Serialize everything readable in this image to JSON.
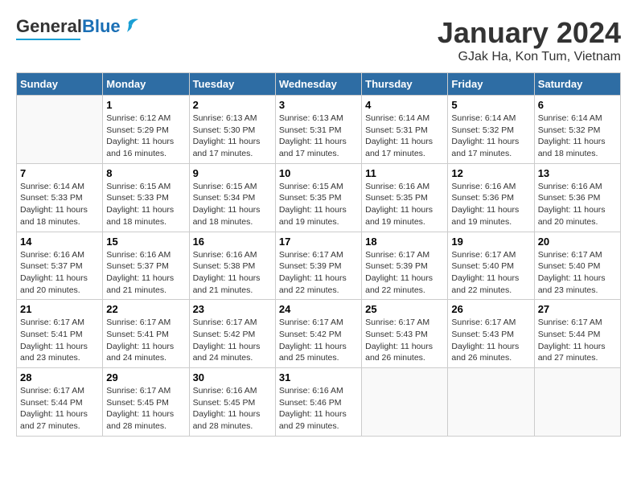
{
  "header": {
    "logo_general": "General",
    "logo_blue": "Blue",
    "title": "January 2024",
    "subtitle": "GJak Ha, Kon Tum, Vietnam"
  },
  "weekdays": [
    "Sunday",
    "Monday",
    "Tuesday",
    "Wednesday",
    "Thursday",
    "Friday",
    "Saturday"
  ],
  "weeks": [
    [
      {
        "day": "",
        "sunrise": "",
        "sunset": "",
        "daylight": ""
      },
      {
        "day": "1",
        "sunrise": "Sunrise: 6:12 AM",
        "sunset": "Sunset: 5:29 PM",
        "daylight": "Daylight: 11 hours and 16 minutes."
      },
      {
        "day": "2",
        "sunrise": "Sunrise: 6:13 AM",
        "sunset": "Sunset: 5:30 PM",
        "daylight": "Daylight: 11 hours and 17 minutes."
      },
      {
        "day": "3",
        "sunrise": "Sunrise: 6:13 AM",
        "sunset": "Sunset: 5:31 PM",
        "daylight": "Daylight: 11 hours and 17 minutes."
      },
      {
        "day": "4",
        "sunrise": "Sunrise: 6:14 AM",
        "sunset": "Sunset: 5:31 PM",
        "daylight": "Daylight: 11 hours and 17 minutes."
      },
      {
        "day": "5",
        "sunrise": "Sunrise: 6:14 AM",
        "sunset": "Sunset: 5:32 PM",
        "daylight": "Daylight: 11 hours and 17 minutes."
      },
      {
        "day": "6",
        "sunrise": "Sunrise: 6:14 AM",
        "sunset": "Sunset: 5:32 PM",
        "daylight": "Daylight: 11 hours and 18 minutes."
      }
    ],
    [
      {
        "day": "7",
        "sunrise": "Sunrise: 6:14 AM",
        "sunset": "Sunset: 5:33 PM",
        "daylight": "Daylight: 11 hours and 18 minutes."
      },
      {
        "day": "8",
        "sunrise": "Sunrise: 6:15 AM",
        "sunset": "Sunset: 5:33 PM",
        "daylight": "Daylight: 11 hours and 18 minutes."
      },
      {
        "day": "9",
        "sunrise": "Sunrise: 6:15 AM",
        "sunset": "Sunset: 5:34 PM",
        "daylight": "Daylight: 11 hours and 18 minutes."
      },
      {
        "day": "10",
        "sunrise": "Sunrise: 6:15 AM",
        "sunset": "Sunset: 5:35 PM",
        "daylight": "Daylight: 11 hours and 19 minutes."
      },
      {
        "day": "11",
        "sunrise": "Sunrise: 6:16 AM",
        "sunset": "Sunset: 5:35 PM",
        "daylight": "Daylight: 11 hours and 19 minutes."
      },
      {
        "day": "12",
        "sunrise": "Sunrise: 6:16 AM",
        "sunset": "Sunset: 5:36 PM",
        "daylight": "Daylight: 11 hours and 19 minutes."
      },
      {
        "day": "13",
        "sunrise": "Sunrise: 6:16 AM",
        "sunset": "Sunset: 5:36 PM",
        "daylight": "Daylight: 11 hours and 20 minutes."
      }
    ],
    [
      {
        "day": "14",
        "sunrise": "Sunrise: 6:16 AM",
        "sunset": "Sunset: 5:37 PM",
        "daylight": "Daylight: 11 hours and 20 minutes."
      },
      {
        "day": "15",
        "sunrise": "Sunrise: 6:16 AM",
        "sunset": "Sunset: 5:37 PM",
        "daylight": "Daylight: 11 hours and 21 minutes."
      },
      {
        "day": "16",
        "sunrise": "Sunrise: 6:16 AM",
        "sunset": "Sunset: 5:38 PM",
        "daylight": "Daylight: 11 hours and 21 minutes."
      },
      {
        "day": "17",
        "sunrise": "Sunrise: 6:17 AM",
        "sunset": "Sunset: 5:39 PM",
        "daylight": "Daylight: 11 hours and 22 minutes."
      },
      {
        "day": "18",
        "sunrise": "Sunrise: 6:17 AM",
        "sunset": "Sunset: 5:39 PM",
        "daylight": "Daylight: 11 hours and 22 minutes."
      },
      {
        "day": "19",
        "sunrise": "Sunrise: 6:17 AM",
        "sunset": "Sunset: 5:40 PM",
        "daylight": "Daylight: 11 hours and 22 minutes."
      },
      {
        "day": "20",
        "sunrise": "Sunrise: 6:17 AM",
        "sunset": "Sunset: 5:40 PM",
        "daylight": "Daylight: 11 hours and 23 minutes."
      }
    ],
    [
      {
        "day": "21",
        "sunrise": "Sunrise: 6:17 AM",
        "sunset": "Sunset: 5:41 PM",
        "daylight": "Daylight: 11 hours and 23 minutes."
      },
      {
        "day": "22",
        "sunrise": "Sunrise: 6:17 AM",
        "sunset": "Sunset: 5:41 PM",
        "daylight": "Daylight: 11 hours and 24 minutes."
      },
      {
        "day": "23",
        "sunrise": "Sunrise: 6:17 AM",
        "sunset": "Sunset: 5:42 PM",
        "daylight": "Daylight: 11 hours and 24 minutes."
      },
      {
        "day": "24",
        "sunrise": "Sunrise: 6:17 AM",
        "sunset": "Sunset: 5:42 PM",
        "daylight": "Daylight: 11 hours and 25 minutes."
      },
      {
        "day": "25",
        "sunrise": "Sunrise: 6:17 AM",
        "sunset": "Sunset: 5:43 PM",
        "daylight": "Daylight: 11 hours and 26 minutes."
      },
      {
        "day": "26",
        "sunrise": "Sunrise: 6:17 AM",
        "sunset": "Sunset: 5:43 PM",
        "daylight": "Daylight: 11 hours and 26 minutes."
      },
      {
        "day": "27",
        "sunrise": "Sunrise: 6:17 AM",
        "sunset": "Sunset: 5:44 PM",
        "daylight": "Daylight: 11 hours and 27 minutes."
      }
    ],
    [
      {
        "day": "28",
        "sunrise": "Sunrise: 6:17 AM",
        "sunset": "Sunset: 5:44 PM",
        "daylight": "Daylight: 11 hours and 27 minutes."
      },
      {
        "day": "29",
        "sunrise": "Sunrise: 6:17 AM",
        "sunset": "Sunset: 5:45 PM",
        "daylight": "Daylight: 11 hours and 28 minutes."
      },
      {
        "day": "30",
        "sunrise": "Sunrise: 6:16 AM",
        "sunset": "Sunset: 5:45 PM",
        "daylight": "Daylight: 11 hours and 28 minutes."
      },
      {
        "day": "31",
        "sunrise": "Sunrise: 6:16 AM",
        "sunset": "Sunset: 5:46 PM",
        "daylight": "Daylight: 11 hours and 29 minutes."
      },
      {
        "day": "",
        "sunrise": "",
        "sunset": "",
        "daylight": ""
      },
      {
        "day": "",
        "sunrise": "",
        "sunset": "",
        "daylight": ""
      },
      {
        "day": "",
        "sunrise": "",
        "sunset": "",
        "daylight": ""
      }
    ]
  ]
}
